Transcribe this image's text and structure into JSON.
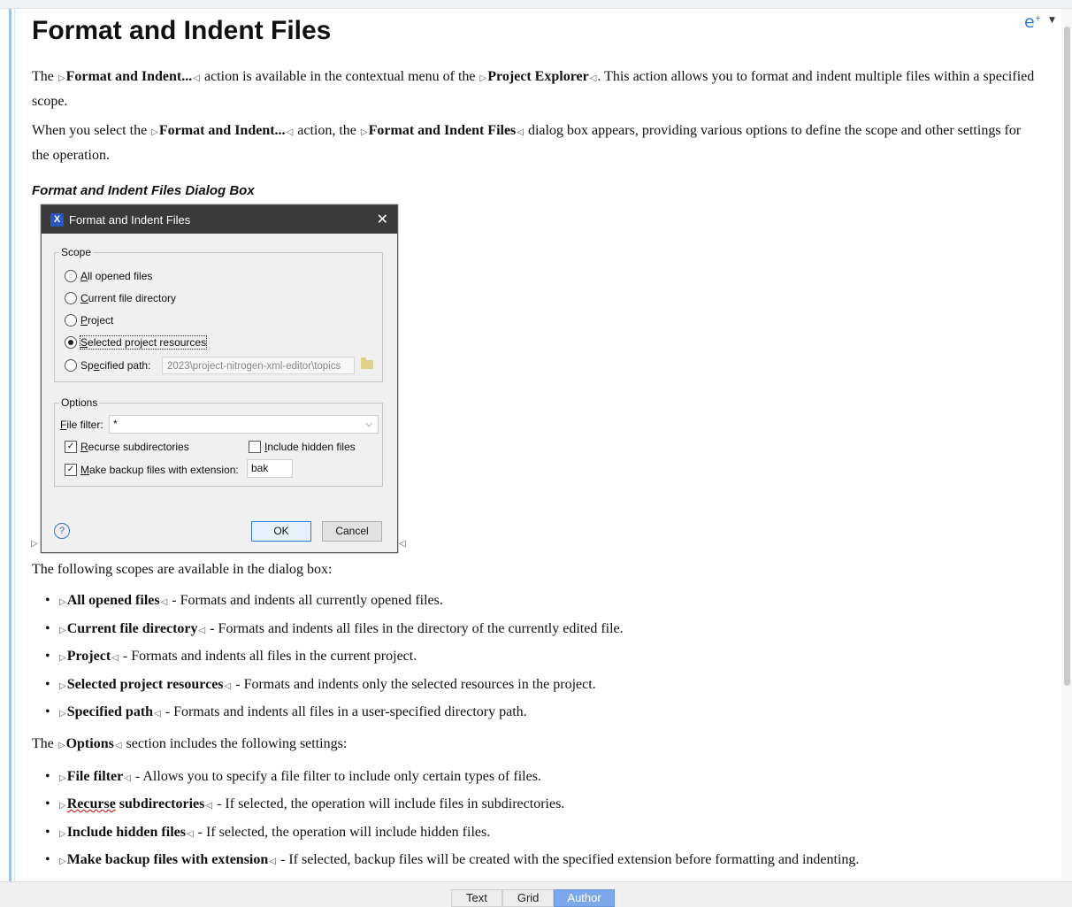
{
  "title": "Format and Indent Files",
  "para1": {
    "t1": "The ",
    "b1": "Format and Indent...",
    "t2": " action is available in the contextual menu of the ",
    "b2": "Project Explorer",
    "t3": ". This action allows you to format and indent multiple files within a specified scope."
  },
  "para2": {
    "t1": "When you select the ",
    "b1": "Format and Indent...",
    "t2": " action, the ",
    "b2": "Format and Indent Files",
    "t3": " dialog box appears, providing various options to define the scope and other settings for the operation."
  },
  "figure_title": "Format and Indent Files Dialog Box",
  "dialog": {
    "title": "Format and Indent Files",
    "logo": "X",
    "close": "✕",
    "scope_label": "Scope",
    "radios": [
      {
        "accel": "A",
        "rest": "ll opened files"
      },
      {
        "accel": "C",
        "rest": "urrent file directory"
      },
      {
        "accel": "P",
        "rest": "roject"
      },
      {
        "accel": "S",
        "rest": "elected project resources"
      },
      {
        "pre": "Sp",
        "accel": "e",
        "rest": "cified path:"
      }
    ],
    "selected_index": 3,
    "path_value": "2023\\project-nitrogen-xml-editor\\topics",
    "options_label": "Options",
    "file_filter_accel": "F",
    "file_filter_rest": "ile filter:",
    "file_filter_value": "*",
    "recurse_accel": "R",
    "recurse_rest": "ecurse subdirectories",
    "recurse_checked": true,
    "hidden_accel": "I",
    "hidden_rest": "nclude hidden files",
    "hidden_checked": false,
    "backup_accel": "M",
    "backup_rest": "ake backup files with extension:",
    "backup_checked": true,
    "backup_ext": "bak",
    "ok": "OK",
    "cancel": "Cancel",
    "help": "?"
  },
  "scopes_intro": "The following scopes are available in the dialog box:",
  "scopes": [
    {
      "term": "All opened files",
      "desc": " - Formats and indents all currently opened files."
    },
    {
      "term": "Current file directory",
      "desc": " - Formats and indents all files in the directory of the currently edited file."
    },
    {
      "term": "Project",
      "desc": " - Formats and indents all files in the current project."
    },
    {
      "term": "Selected project resources",
      "desc": " - Formats and indents only the selected resources in the project."
    },
    {
      "term": "Specified path",
      "desc": " - Formats and indents all files in a user-specified directory path."
    }
  ],
  "options_intro": {
    "t1": "The ",
    "b1": "Options",
    "t2": " section includes the following settings:"
  },
  "options": [
    {
      "term": "File filter",
      "desc": " - Allows you to specify a file filter to include only certain types of files."
    },
    {
      "term_a": "Recurse",
      "term_b": " subdirectories",
      "desc": " - If selected, the operation will include files in subdirectories."
    },
    {
      "term": "Include hidden files",
      "desc": " - If selected, the operation will include hidden files."
    },
    {
      "term": "Make backup files with extension",
      "desc": " - If selected, backup files will be created with the specified extension before formatting and indenting."
    }
  ],
  "tabs": [
    "Text",
    "Grid",
    "Author"
  ],
  "active_tab": "Author",
  "tag_open": "▷",
  "tag_close": "◁",
  "accent_color": "#7ba8ea"
}
